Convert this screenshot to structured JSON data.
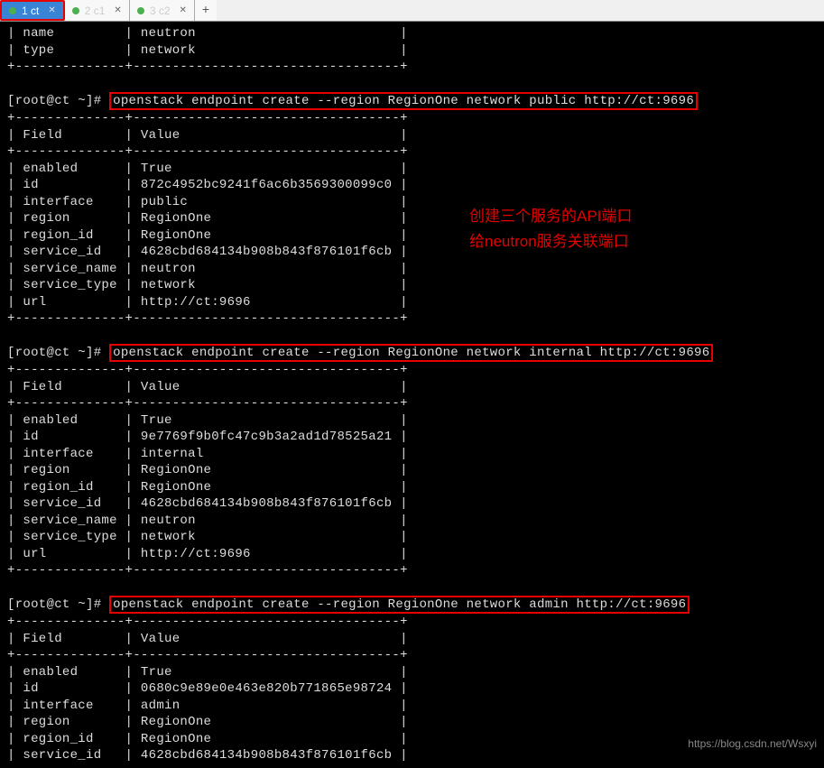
{
  "tabs": [
    {
      "label": "1 ct",
      "active": true
    },
    {
      "label": "2 c1",
      "active": false
    },
    {
      "label": "3 c2",
      "active": false
    }
  ],
  "tab_add": "+",
  "top_rows": [
    {
      "f": "name",
      "v": "neutron"
    },
    {
      "f": "type",
      "v": "network"
    }
  ],
  "prompt": "[root@ct ~]# ",
  "commands": {
    "c1": "openstack endpoint create --region RegionOne network public http://ct:9696",
    "c2": "openstack endpoint create --region RegionOne network internal http://ct:9696",
    "c3": "openstack endpoint create --region RegionOne network admin http://ct:9696"
  },
  "header": {
    "field": "Field",
    "value": "Value"
  },
  "table1": [
    {
      "f": "enabled",
      "v": "True"
    },
    {
      "f": "id",
      "v": "872c4952bc9241f6ac6b3569300099c0"
    },
    {
      "f": "interface",
      "v": "public"
    },
    {
      "f": "region",
      "v": "RegionOne"
    },
    {
      "f": "region_id",
      "v": "RegionOne"
    },
    {
      "f": "service_id",
      "v": "4628cbd684134b908b843f876101f6cb"
    },
    {
      "f": "service_name",
      "v": "neutron"
    },
    {
      "f": "service_type",
      "v": "network"
    },
    {
      "f": "url",
      "v": "http://ct:9696"
    }
  ],
  "table2": [
    {
      "f": "enabled",
      "v": "True"
    },
    {
      "f": "id",
      "v": "9e7769f9b0fc47c9b3a2ad1d78525a21"
    },
    {
      "f": "interface",
      "v": "internal"
    },
    {
      "f": "region",
      "v": "RegionOne"
    },
    {
      "f": "region_id",
      "v": "RegionOne"
    },
    {
      "f": "service_id",
      "v": "4628cbd684134b908b843f876101f6cb"
    },
    {
      "f": "service_name",
      "v": "neutron"
    },
    {
      "f": "service_type",
      "v": "network"
    },
    {
      "f": "url",
      "v": "http://ct:9696"
    }
  ],
  "table3": [
    {
      "f": "enabled",
      "v": "True"
    },
    {
      "f": "id",
      "v": "0680c9e89e0e463e820b771865e98724"
    },
    {
      "f": "interface",
      "v": "admin"
    },
    {
      "f": "region",
      "v": "RegionOne"
    },
    {
      "f": "region_id",
      "v": "RegionOne"
    },
    {
      "f": "service_id",
      "v": "4628cbd684134b908b843f876101f6cb"
    }
  ],
  "annotation": {
    "line1": "创建三个服务的API端口",
    "line2": "给neutron服务关联端口"
  },
  "watermark": "https://blog.csdn.net/Wsxyi"
}
